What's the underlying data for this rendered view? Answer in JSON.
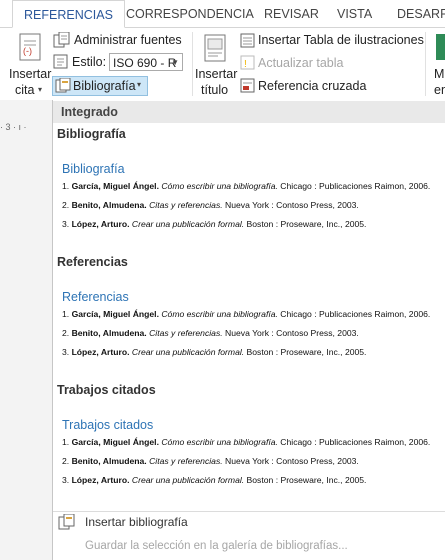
{
  "tabs": [
    "REFERENCIAS",
    "CORRESPONDENCIA",
    "REVISAR",
    "VISTA",
    "DESARRO"
  ],
  "ribbon": {
    "insertar_cita": [
      "Insertar",
      "cita"
    ],
    "administrar_fuentes": "Administrar fuentes",
    "estilo_label": "Estilo:",
    "estilo_value": "ISO 690 - R",
    "bibliografia_label": "Bibliografía",
    "insertar_titulo": [
      "Insertar",
      "título"
    ],
    "insertar_tabla": "Insertar Tabla de ilustraciones",
    "actualizar_tabla": "Actualizar tabla",
    "referencia_cruzada": "Referencia cruzada",
    "cut_label": [
      "M",
      "en"
    ]
  },
  "ruler_text": "· 3 · ı ·",
  "gallery": {
    "header": "Integrado",
    "sections": [
      {
        "section_label": "Bibliografía",
        "entry_title": "Bibliografía",
        "citations": [
          {
            "num": "1.",
            "author": "García, Miguel Ángel.",
            "title": "Cómo escribir una bibliografía.",
            "rest": "Chicago : Publicaciones Raimon, 2006."
          },
          {
            "num": "2.",
            "author": "Benito, Almudena.",
            "title": "Citas y referencias.",
            "rest": "Nueva York : Contoso Press, 2003."
          },
          {
            "num": "3.",
            "author": "López, Arturo.",
            "title": "Crear una publicación formal.",
            "rest": "Boston : Proseware, Inc., 2005."
          }
        ]
      },
      {
        "section_label": "Referencias",
        "entry_title": "Referencias",
        "citations": [
          {
            "num": "1.",
            "author": "García, Miguel Ángel.",
            "title": "Cómo escribir una bibliografía.",
            "rest": "Chicago : Publicaciones Raimon, 2006."
          },
          {
            "num": "2.",
            "author": "Benito, Almudena.",
            "title": "Citas y referencias.",
            "rest": "Nueva York : Contoso Press, 2003."
          },
          {
            "num": "3.",
            "author": "López, Arturo.",
            "title": "Crear una publicación formal.",
            "rest": "Boston : Proseware, Inc., 2005."
          }
        ]
      },
      {
        "section_label": "Trabajos citados",
        "entry_title": "Trabajos citados",
        "citations": [
          {
            "num": "1.",
            "author": "García, Miguel Ángel.",
            "title": "Cómo escribir una bibliografía.",
            "rest": "Chicago : Publicaciones Raimon, 2006."
          },
          {
            "num": "2.",
            "author": "Benito, Almudena.",
            "title": "Citas y referencias.",
            "rest": "Nueva York : Contoso Press, 2003."
          },
          {
            "num": "3.",
            "author": "López, Arturo.",
            "title": "Crear una publicación formal.",
            "rest": "Boston : Proseware, Inc., 2005."
          }
        ]
      }
    ],
    "insertar_bibliografia": "Insertar bibliografía",
    "guardar_seleccion": "Guardar la selección en la galería de bibliografías..."
  },
  "colors": {
    "accent": "#2b579a",
    "link_blue": "#2e74b5",
    "highlight": "#cde6f7"
  },
  "icons": [
    "insert-citation-icon",
    "manage-sources-icon",
    "style-icon",
    "bibliography-icon",
    "insert-caption-icon",
    "insert-table-figures-icon",
    "update-table-icon",
    "cross-reference-icon",
    "insert-bibliography-icon",
    "chevron-down-icon"
  ]
}
